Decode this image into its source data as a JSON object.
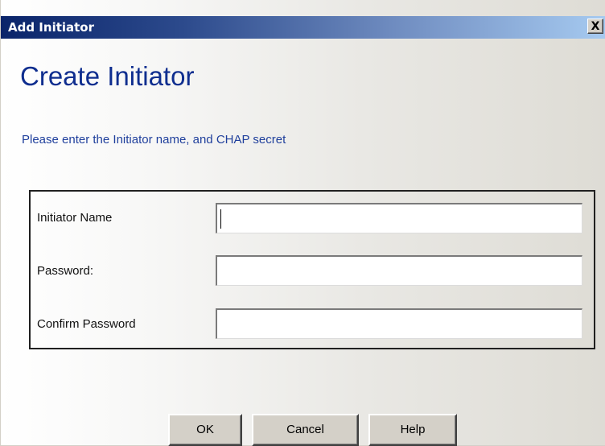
{
  "window": {
    "title": "Add Initiator",
    "close_glyph": "X"
  },
  "header": {
    "heading": "Create Initiator",
    "subheading": "Please enter the Initiator name, and CHAP secret"
  },
  "form": {
    "fields": [
      {
        "label": "Initiator Name",
        "value": "",
        "focused": true
      },
      {
        "label": "Password:",
        "value": ""
      },
      {
        "label": "Confirm Password",
        "value": ""
      }
    ]
  },
  "buttons": {
    "ok": "OK",
    "cancel": "Cancel",
    "help": "Help"
  },
  "icons": {
    "close": "close-icon"
  },
  "colors": {
    "title_bar_start": "#0a246a",
    "title_bar_end": "#a6caf0",
    "heading": "#0f2e8f",
    "subheading": "#1f3f9c",
    "button_face": "#d4d0c8"
  }
}
